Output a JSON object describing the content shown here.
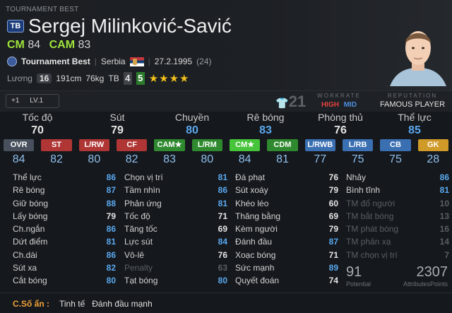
{
  "player": {
    "tag": "TOURNAMENT BEST",
    "season_badge": "TB",
    "name": "Sergej Milinković-Savić",
    "positions": [
      {
        "pos": "CM",
        "val": "84"
      },
      {
        "pos": "CAM",
        "val": "83"
      }
    ],
    "season": "Tournament Best",
    "nation": "Serbia",
    "birth": "27.2.1995",
    "age": "(24)",
    "salary_label": "Lương",
    "salary": "16",
    "height": "191cm",
    "weight": "76kg",
    "foot": "TB",
    "weak_left": "4",
    "weak_right": "5",
    "stars": "★★★★"
  },
  "bar": {
    "lv_plus": "+1",
    "lv": "LV.1",
    "shirt_no": "21",
    "workrate_title": "WORKRATE",
    "wr_high": "HIGH",
    "wr_mid": "MID",
    "rep_title": "REPUTATION",
    "rep_value": "FAMOUS PLAYER"
  },
  "categories": [
    {
      "name": "Tốc độ",
      "val": "70",
      "color": "#e6e6e6"
    },
    {
      "name": "Sút",
      "val": "79",
      "color": "#e6e6e6"
    },
    {
      "name": "Chuyền",
      "val": "80",
      "color": "#5aa9f0"
    },
    {
      "name": "Rê bóng",
      "val": "83",
      "color": "#5aa9f0"
    },
    {
      "name": "Phòng thủ",
      "val": "76",
      "color": "#e6e6e6"
    },
    {
      "name": "Thể lực",
      "val": "85",
      "color": "#5aa9f0"
    }
  ],
  "positions": [
    {
      "label": "OVR",
      "val": "84",
      "bg": "#47505c"
    },
    {
      "label": "ST",
      "val": "82",
      "bg": "#b03535"
    },
    {
      "label": "L/RW",
      "val": "80",
      "bg": "#b03535"
    },
    {
      "label": "CF",
      "val": "82",
      "bg": "#b03535"
    },
    {
      "label": "CAM★",
      "val": "83",
      "bg": "#2f8a2f"
    },
    {
      "label": "L/RM",
      "val": "80",
      "bg": "#2f8a2f"
    },
    {
      "label": "CM★",
      "val": "84",
      "bg": "#46c43a"
    },
    {
      "label": "CDM",
      "val": "81",
      "bg": "#2f8a2f"
    },
    {
      "label": "L/RWB",
      "val": "77",
      "bg": "#3a6fb2"
    },
    {
      "label": "L/RB",
      "val": "75",
      "bg": "#3a6fb2"
    },
    {
      "label": "CB",
      "val": "75",
      "bg": "#3a6fb2"
    },
    {
      "label": "GK",
      "val": "28",
      "bg": "#d09a28"
    }
  ],
  "attributes": [
    [
      [
        "Thể lực",
        "86",
        "#5aa9f0"
      ],
      [
        "Rê bóng",
        "87",
        "#5aa9f0"
      ],
      [
        "Giữ bóng",
        "88",
        "#5aa9f0"
      ],
      [
        "Lấy bóng",
        "79",
        "#e6e6e6"
      ],
      [
        "Ch.ngắn",
        "86",
        "#5aa9f0"
      ],
      [
        "Dứt điểm",
        "81",
        "#5aa9f0"
      ],
      [
        "Ch.dài",
        "86",
        "#5aa9f0"
      ],
      [
        "Sút xa",
        "82",
        "#5aa9f0"
      ],
      [
        "Cắt bóng",
        "80",
        "#5aa9f0"
      ]
    ],
    [
      [
        "Chọn vị trí",
        "81",
        "#5aa9f0"
      ],
      [
        "Tầm nhìn",
        "86",
        "#5aa9f0"
      ],
      [
        "Phản ứng",
        "81",
        "#5aa9f0"
      ],
      [
        "Tốc độ",
        "71",
        "#e6e6e6"
      ],
      [
        "Tăng tốc",
        "69",
        "#e6e6e6"
      ],
      [
        "Lực sút",
        "84",
        "#5aa9f0"
      ],
      [
        "Vô-lê",
        "76",
        "#e6e6e6"
      ],
      [
        "Penalty",
        "63",
        "#5b5f64"
      ],
      [
        "Tạt bóng",
        "80",
        "#5aa9f0"
      ]
    ],
    [
      [
        "Đá phạt",
        "76",
        "#e6e6e6"
      ],
      [
        "Sút xoáy",
        "79",
        "#e6e6e6"
      ],
      [
        "Khéo léo",
        "60",
        "#e6e6e6"
      ],
      [
        "Thăng bằng",
        "69",
        "#e6e6e6"
      ],
      [
        "Kèm người",
        "79",
        "#e6e6e6"
      ],
      [
        "Đánh đầu",
        "87",
        "#5aa9f0"
      ],
      [
        "Xoạc bóng",
        "71",
        "#e6e6e6"
      ],
      [
        "Sức mạnh",
        "89",
        "#5aa9f0"
      ],
      [
        "Quyết đoán",
        "74",
        "#e6e6e6"
      ]
    ],
    [
      [
        "Nhảy",
        "86",
        "#5aa9f0"
      ],
      [
        "Bình tĩnh",
        "81",
        "#5aa9f0"
      ],
      [
        "TM đổ người",
        "10",
        "#5b5f64"
      ],
      [
        "TM bắt bóng",
        "13",
        "#5b5f64"
      ],
      [
        "TM phát bóng",
        "16",
        "#5b5f64"
      ],
      [
        "TM phản xạ",
        "14",
        "#5b5f64"
      ],
      [
        "TM chọn vị trí",
        "7",
        "#5b5f64"
      ]
    ]
  ],
  "summary": {
    "potential": "91",
    "potential_label": "Potential",
    "attr_points": "2307",
    "attr_points_label": "AttributesPoints"
  },
  "footer": {
    "label": "C.Số ẩn :",
    "traits": "Tinh tế   Đánh đầu mạnh"
  }
}
